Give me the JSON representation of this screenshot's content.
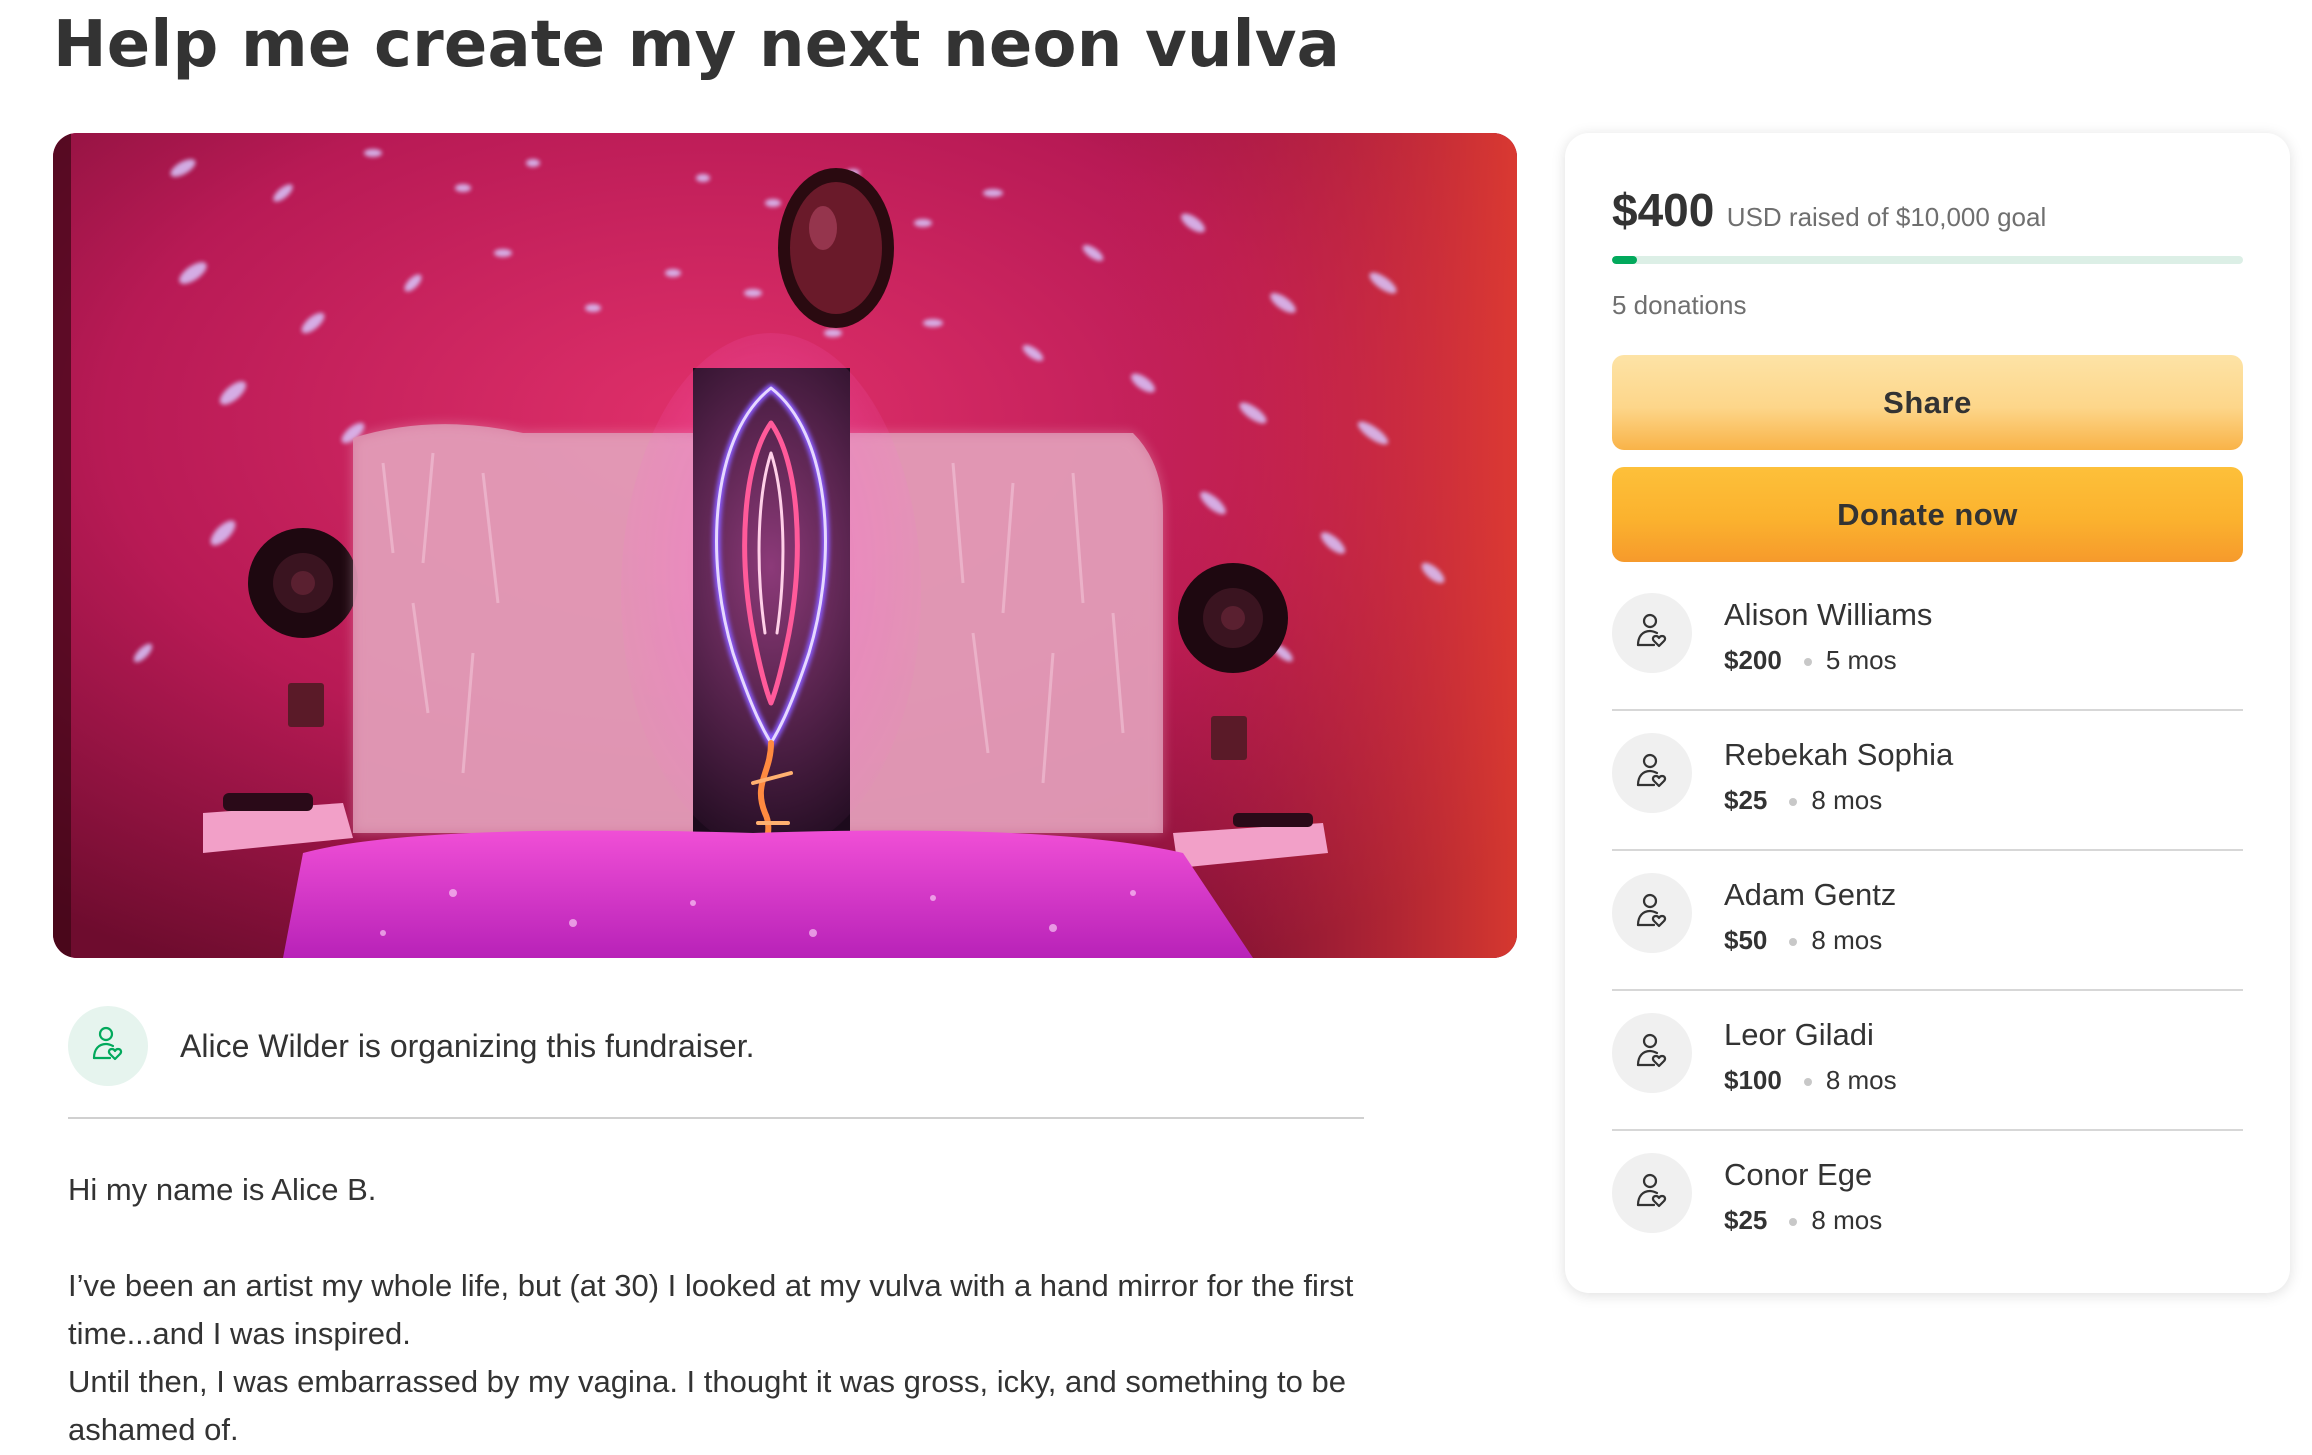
{
  "campaign": {
    "title": "Help me create my next neon vulva"
  },
  "organizer": {
    "text": "Alice Wilder is organizing this fundraiser.",
    "icon": "user-heart-icon"
  },
  "story": {
    "paragraph1": "Hi my name is Alice B.",
    "paragraph2": "I’ve been an artist my whole life, but (at 30) I looked at my vulva with a hand mirror for the first time...and I was inspired.",
    "paragraph3": "Until then, I was embarrassed by my vagina. I thought it was gross, icky, and something to be ashamed of."
  },
  "progress": {
    "raised": "$400",
    "raised_text": "USD raised of $10,000 goal",
    "fraction": 0.04,
    "donations_label": "5 donations"
  },
  "buttons": {
    "share": "Share",
    "donate": "Donate now"
  },
  "donors": [
    {
      "name": "Alison Williams",
      "amount": "$200",
      "time": "5 mos"
    },
    {
      "name": "Rebekah Sophia",
      "amount": "$25",
      "time": "8 mos"
    },
    {
      "name": "Adam Gentz",
      "amount": "$50",
      "time": "8 mos"
    },
    {
      "name": "Leor Giladi",
      "amount": "$100",
      "time": "8 mos"
    },
    {
      "name": "Conor Ege",
      "amount": "$25",
      "time": "8 mos"
    }
  ],
  "colors": {
    "accent_green": "#02a95c",
    "progress_track": "#dcefe6",
    "share_button": "#fdd68a",
    "donate_button": "#fbb22e",
    "text": "#333333"
  }
}
